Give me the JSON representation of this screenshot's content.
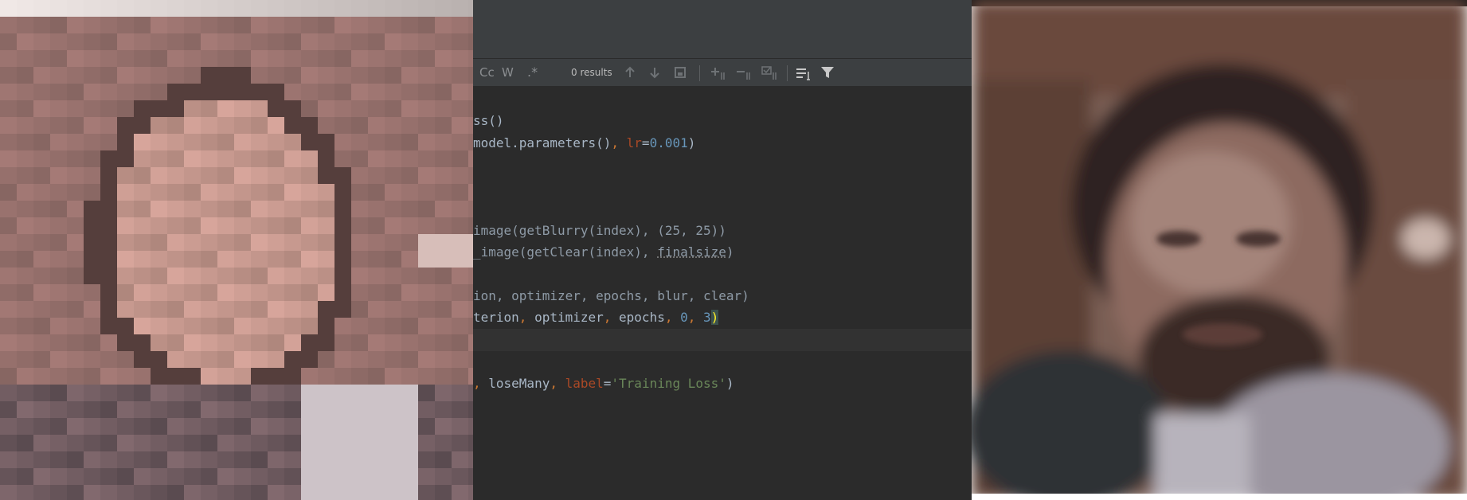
{
  "find_bar": {
    "match_case_label": "Cc",
    "words_label": "W",
    "regex_label": ".*",
    "results_text": "0 results"
  },
  "code_lines": {
    "l1": "ss()",
    "l2_a": "model.parameters()",
    "l2_b": ", ",
    "l2_c": "lr",
    "l2_d": "=",
    "l2_e": "0.001",
    "l2_f": ")",
    "l3": "image(getBlurry(index), (25, 25))",
    "l4_a": "_image(getClear(index), ",
    "l4_b": "finalsize",
    "l4_c": ")",
    "l5": "ion, optimizer, epochs, blur, clear)",
    "l6_a": "terion",
    "l6_b": ", ",
    "l6_c": "optimizer",
    "l6_d": ", ",
    "l6_e": "epochs",
    "l6_f": ", ",
    "l6_g": "0",
    "l6_h": ", ",
    "l6_i": "3",
    "l6_j": ")",
    "l7_a": ", ",
    "l7_b": "loseMany",
    "l7_c": ", ",
    "l7_d": "label",
    "l7_e": "=",
    "l7_f": "'Training Loss'",
    "l7_g": ")"
  },
  "colors": {
    "editor_bg": "#2b2b2b",
    "toolbar_bg": "#3c3f41",
    "number": "#6897bb",
    "keyword": "#cc7832",
    "string": "#6a8759"
  },
  "icons": [
    "arrow-up-icon",
    "arrow-down-icon",
    "select-all-icon",
    "add-cursor-icon",
    "remove-cursor-icon",
    "select-occurrences-icon",
    "filter-options-icon",
    "funnel-icon"
  ]
}
